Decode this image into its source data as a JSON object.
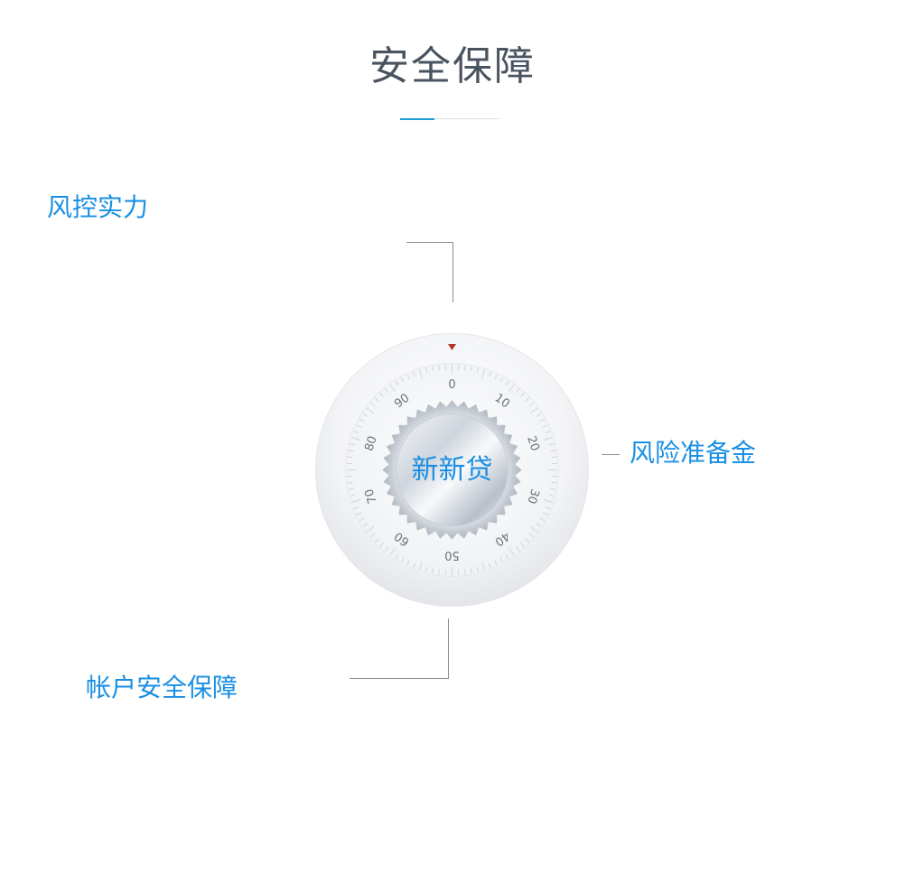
{
  "page": {
    "title": "安全保障"
  },
  "features": {
    "risk_control": "风控实力",
    "risk_reserve": "风险准备金",
    "account_security": "帐户安全保障"
  },
  "dial": {
    "brand": "新新贷",
    "tick_labels": [
      "0",
      "10",
      "20",
      "30",
      "40",
      "50",
      "60",
      "70",
      "80",
      "90"
    ],
    "pointer_color": "#b3342a",
    "accent_color": "#1a8fe3"
  },
  "colors": {
    "title": "#4a5360",
    "label": "#1a8fe3",
    "connector": "#8a8f96",
    "underline_accent": "#1f9bd6"
  }
}
